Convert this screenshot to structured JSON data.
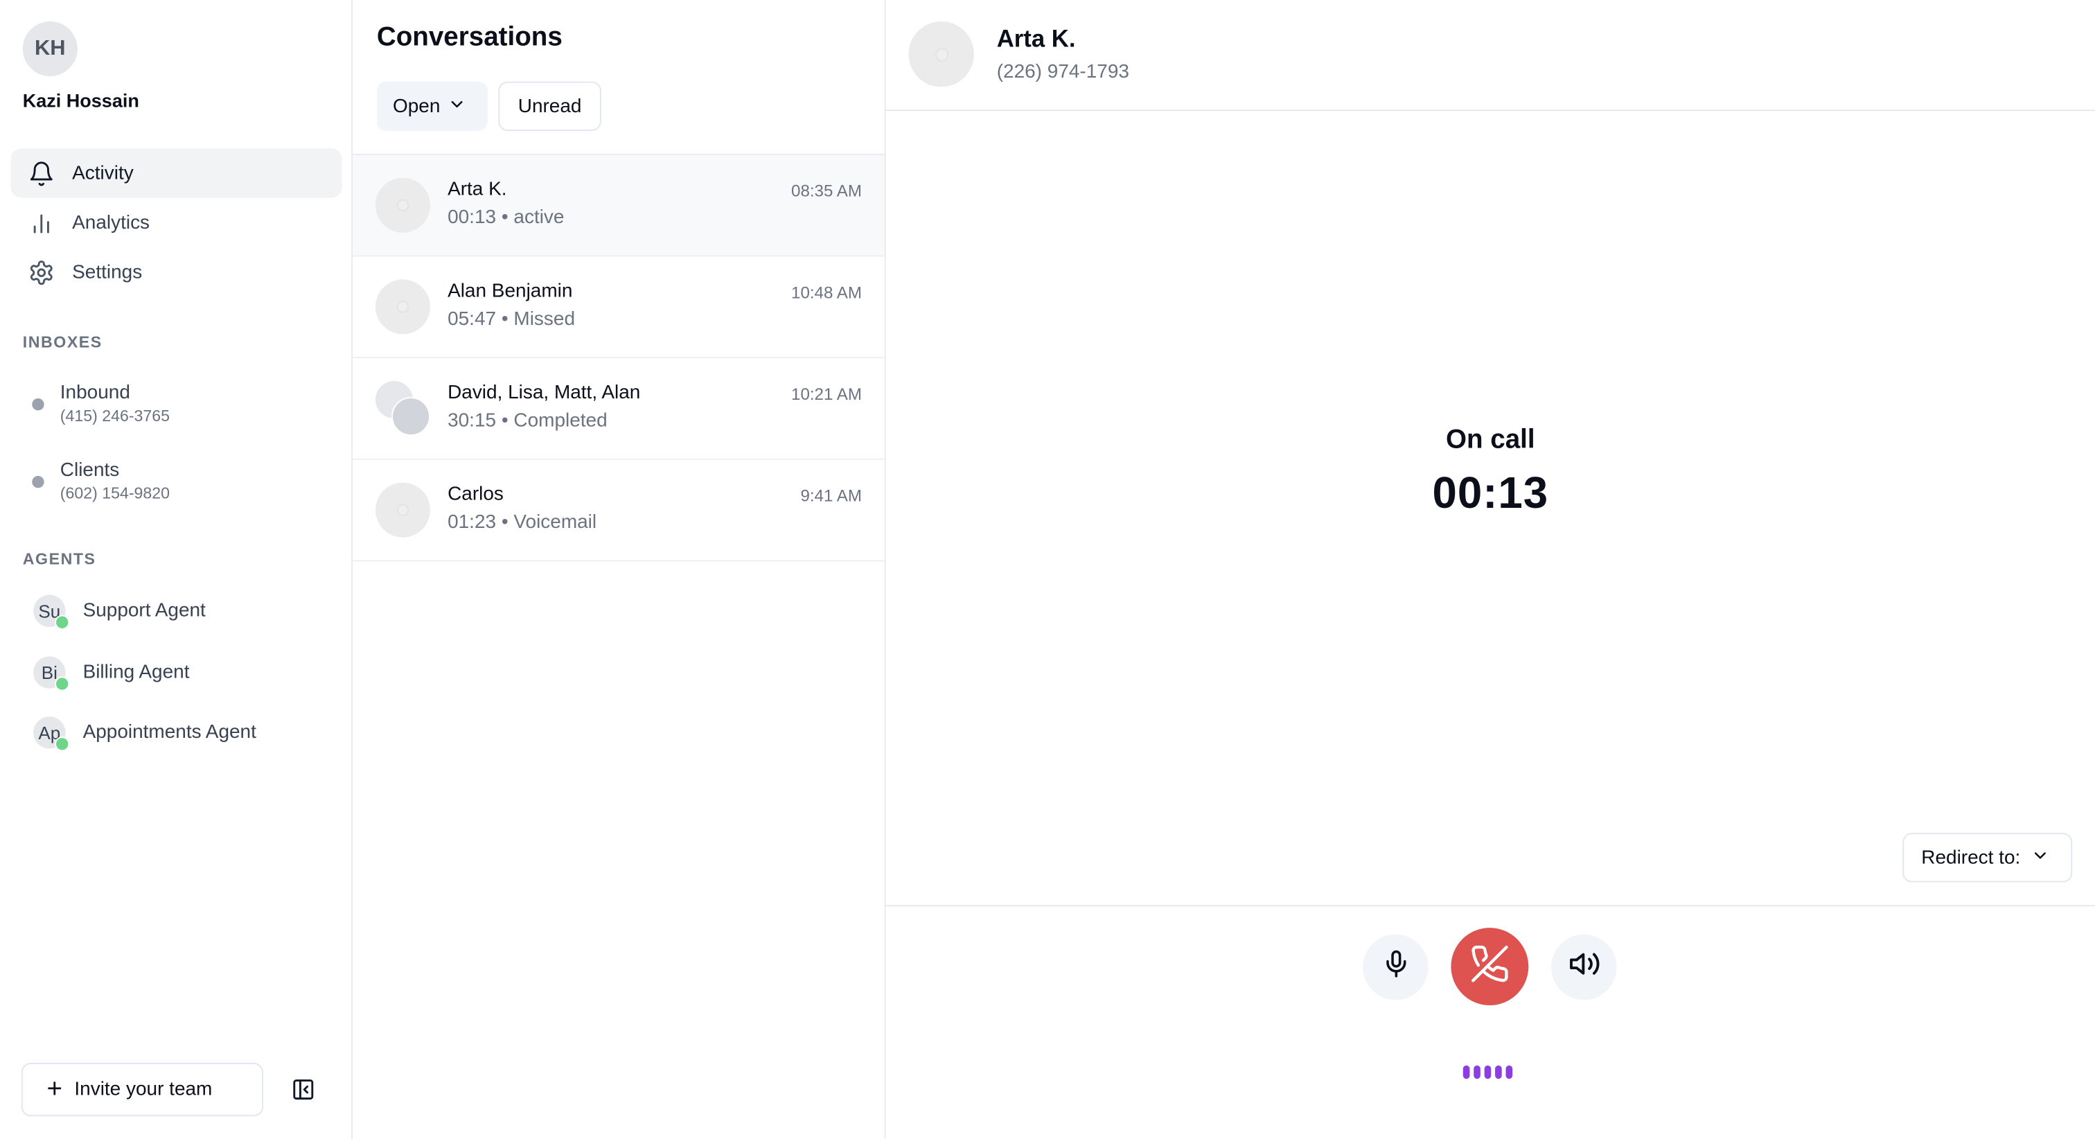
{
  "user": {
    "initials": "KH",
    "name": "Kazi Hossain"
  },
  "nav": [
    {
      "label": "Activity",
      "icon": "bell-icon",
      "active": true
    },
    {
      "label": "Analytics",
      "icon": "bar-chart-icon",
      "active": false
    },
    {
      "label": "Settings",
      "icon": "gear-icon",
      "active": false
    }
  ],
  "inboxes": {
    "label": "INBOXES",
    "items": [
      {
        "name": "Inbound",
        "phone": "(415) 246-3765"
      },
      {
        "name": "Clients",
        "phone": "(602) 154-9820"
      }
    ]
  },
  "agents": {
    "label": "AGENTS",
    "items": [
      {
        "initials": "Su",
        "name": "Support Agent",
        "status": "online"
      },
      {
        "initials": "Bi",
        "name": "Billing Agent",
        "status": "online"
      },
      {
        "initials": "Ap",
        "name": "Appointments Agent",
        "status": "online"
      }
    ]
  },
  "sidebar_footer": {
    "invite_label": "Invite your team",
    "collapse_icon": "sidebar-collapse-icon"
  },
  "conversations": {
    "title": "Conversations",
    "filter_open": "Open",
    "filter_unread": "Unread",
    "items": [
      {
        "name": "Arta K.",
        "duration": "00:13",
        "status": "active",
        "time": "08:35 AM",
        "selected": true,
        "group": false
      },
      {
        "name": "Alan Benjamin",
        "duration": "05:47",
        "status": "Missed",
        "time": "10:48 AM",
        "selected": false,
        "group": false
      },
      {
        "name": "David, Lisa, Matt, Alan",
        "duration": "30:15",
        "status": "Completed",
        "time": "10:21 AM",
        "selected": false,
        "group": true
      },
      {
        "name": "Carlos",
        "duration": "01:23",
        "status": "Voicemail",
        "time": "9:41 AM",
        "selected": false,
        "group": false
      }
    ]
  },
  "call": {
    "contact_name": "Arta K.",
    "contact_phone": "(226) 974-1793",
    "status": "On call",
    "timer": "00:13",
    "redirect_label": "Redirect to:",
    "colors": {
      "hangup": "#de5350",
      "wave": "#8b3fe0",
      "online": "#6ed688"
    }
  }
}
